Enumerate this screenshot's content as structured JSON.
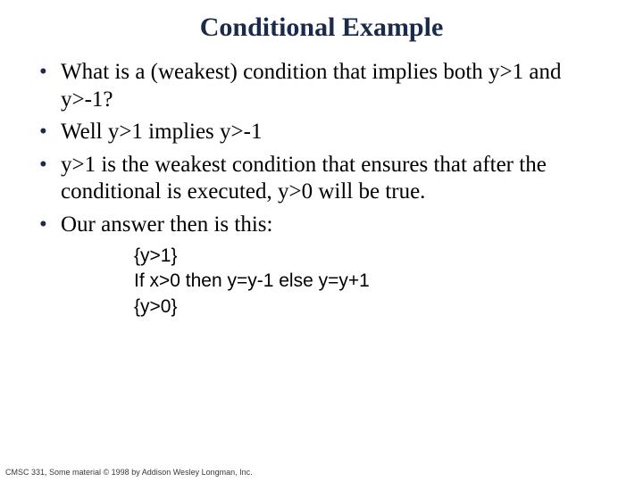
{
  "title": "Conditional Example",
  "bullets": {
    "b0": "What is a (weakest) condition that implies both y>1 and y>-1?",
    "b1": "Well y>1 implies y>-1",
    "b2": "y>1 is the weakest condition that ensures that after the conditional is executed, y>0 will be true.",
    "b3": "Our answer then is this:"
  },
  "code": {
    "l0": "{y>1}",
    "l1": "If x>0 then y=y-1 else y=y+1",
    "l2": "{y>0}"
  },
  "footer": "CMSC 331, Some material © 1998 by Addison Wesley Longman, Inc."
}
